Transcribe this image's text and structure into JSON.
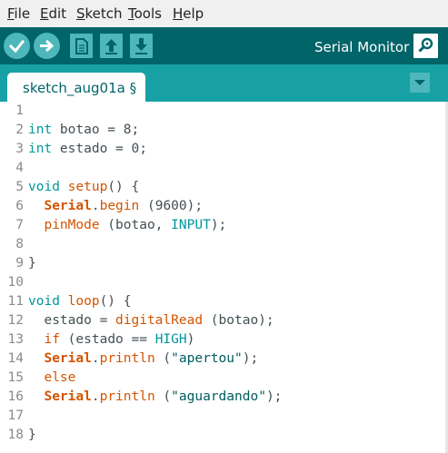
{
  "menu": [
    {
      "key": "F",
      "rest": "ile"
    },
    {
      "key": "E",
      "rest": "dit"
    },
    {
      "key": "S",
      "rest": "ketch"
    },
    {
      "key": "T",
      "rest": "ools"
    },
    {
      "key": "H",
      "rest": "elp"
    }
  ],
  "toolbar": {
    "serial_label": "Serial Monitor",
    "buttons": [
      "check-icon",
      "arrow-right-icon",
      "new-file-icon",
      "upload-arrow-icon",
      "download-arrow-icon"
    ]
  },
  "tab": {
    "label": "sketch_aug01a §"
  },
  "colors": {
    "keyword": "#00979c",
    "function": "#d35400",
    "serial": "#d35400",
    "string": "#005c5f",
    "plain": "#434f54",
    "toolbar": "#006468",
    "tabbar": "#17a1a5",
    "button": "#4db7bb"
  },
  "editor": {
    "lines": [
      [],
      [
        {
          "t": "int",
          "c": "keyword"
        },
        {
          "t": " botao = 8;",
          "c": "plain"
        }
      ],
      [
        {
          "t": "int",
          "c": "keyword"
        },
        {
          "t": " estado = 0;",
          "c": "plain"
        }
      ],
      [],
      [
        {
          "t": "void",
          "c": "keyword"
        },
        {
          "t": " ",
          "c": "plain"
        },
        {
          "t": "setup",
          "c": "function"
        },
        {
          "t": "() {",
          "c": "plain"
        }
      ],
      [
        {
          "t": "  ",
          "c": "plain"
        },
        {
          "t": "Serial",
          "c": "serial",
          "b": true
        },
        {
          "t": ".",
          "c": "plain"
        },
        {
          "t": "begin",
          "c": "function"
        },
        {
          "t": " (9600);",
          "c": "plain"
        }
      ],
      [
        {
          "t": "  ",
          "c": "plain"
        },
        {
          "t": "pinMode",
          "c": "function"
        },
        {
          "t": " (botao, ",
          "c": "plain"
        },
        {
          "t": "INPUT",
          "c": "keyword"
        },
        {
          "t": ");",
          "c": "plain"
        }
      ],
      [],
      [
        {
          "t": "}",
          "c": "plain"
        }
      ],
      [],
      [
        {
          "t": "void",
          "c": "keyword"
        },
        {
          "t": " ",
          "c": "plain"
        },
        {
          "t": "loop",
          "c": "function"
        },
        {
          "t": "() {",
          "c": "plain"
        }
      ],
      [
        {
          "t": "  estado = ",
          "c": "plain"
        },
        {
          "t": "digitalRead",
          "c": "function"
        },
        {
          "t": " (botao);",
          "c": "plain"
        }
      ],
      [
        {
          "t": "  ",
          "c": "plain"
        },
        {
          "t": "if",
          "c": "function"
        },
        {
          "t": " (estado == ",
          "c": "plain"
        },
        {
          "t": "HIGH",
          "c": "keyword"
        },
        {
          "t": ")",
          "c": "plain"
        }
      ],
      [
        {
          "t": "  ",
          "c": "plain"
        },
        {
          "t": "Serial",
          "c": "serial",
          "b": true
        },
        {
          "t": ".",
          "c": "plain"
        },
        {
          "t": "println",
          "c": "function"
        },
        {
          "t": " (",
          "c": "plain"
        },
        {
          "t": "\"apertou\"",
          "c": "string"
        },
        {
          "t": ");",
          "c": "plain"
        }
      ],
      [
        {
          "t": "  ",
          "c": "plain"
        },
        {
          "t": "else",
          "c": "function"
        }
      ],
      [
        {
          "t": "  ",
          "c": "plain"
        },
        {
          "t": "Serial",
          "c": "serial",
          "b": true
        },
        {
          "t": ".",
          "c": "plain"
        },
        {
          "t": "println",
          "c": "function"
        },
        {
          "t": " (",
          "c": "plain"
        },
        {
          "t": "\"aguardando\"",
          "c": "string"
        },
        {
          "t": ");",
          "c": "plain"
        }
      ],
      [],
      [
        {
          "t": "}",
          "c": "plain"
        }
      ]
    ],
    "line_numbers": [
      "1",
      "2",
      "3",
      "4",
      "5",
      "6",
      "7",
      "8",
      "9",
      "10",
      "11",
      "12",
      "13",
      "14",
      "15",
      "16",
      "17",
      "18"
    ]
  }
}
